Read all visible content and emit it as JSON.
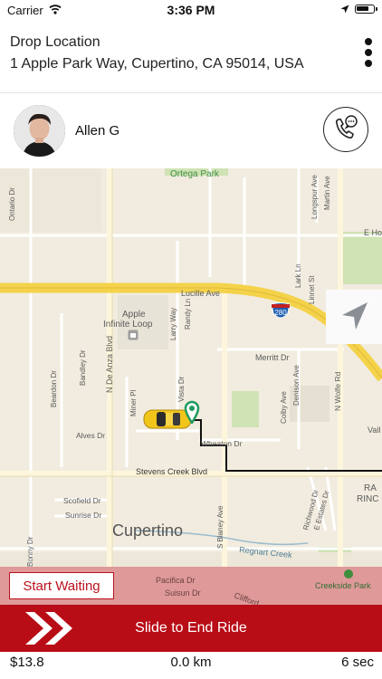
{
  "status_bar": {
    "carrier": "Carrier",
    "time": "3:36 PM"
  },
  "header": {
    "label": "Drop Location",
    "address": "1 Apple Park Way, Cupertino, CA 95014, USA"
  },
  "rider": {
    "name": "Allen G"
  },
  "map": {
    "labels": {
      "ortega_park": "Ortega Park",
      "ontario": "Ontario Dr",
      "longspur": "Longspur Ave",
      "martin": "Martin Ave",
      "e_ho": "E Ho",
      "lucille": "Lucille Ave",
      "lark": "Lark Ln",
      "linnet": "Linnet St",
      "apple": "Apple",
      "infinite_loop": "Infinite Loop",
      "randy": "Randy Ln",
      "larry": "Larry Way",
      "shield": "280",
      "bandley": "Bandley Dr",
      "de_anza": "N De Anza Blvd",
      "merritt": "Merritt Dr",
      "beardon": "Beardon Dr",
      "vista": "Vista Dr",
      "denison": "Denison Ave",
      "colby": "Colby Ave",
      "wolfe": "N Wolfe Rd",
      "vall": "Vall",
      "miner": "Miner Pl",
      "alves": "Alves Dr",
      "wheaton": "Wheaton Dr",
      "stevens_creek": "Stevens Creek Blvd",
      "ra": "RA",
      "rinc": "RINC",
      "scofield": "Scofield Dr",
      "sunrise": "Sunrise Dr",
      "blaney": "S Blaney Ave",
      "richwood": "Richwood Dr",
      "e_estates": "E Estates Dr",
      "cupertino": "Cupertino",
      "regnart": "Regnart Creek",
      "bonny": "Bonny Dr",
      "pacifica": "Pacifica Dr",
      "suisun": "Suisun Dr",
      "clifford": "Clifford",
      "creekside": "Creekside Park"
    }
  },
  "actions": {
    "start_waiting": "Start Waiting",
    "slide_to_end": "Slide to End Ride"
  },
  "trip": {
    "fare": "$13.8",
    "distance": "0.0 km",
    "duration": "6 sec"
  },
  "colors": {
    "brand_red": "#b80c16",
    "highway_yellow": "#f4d24a",
    "map_background": "#f1ecdf"
  }
}
